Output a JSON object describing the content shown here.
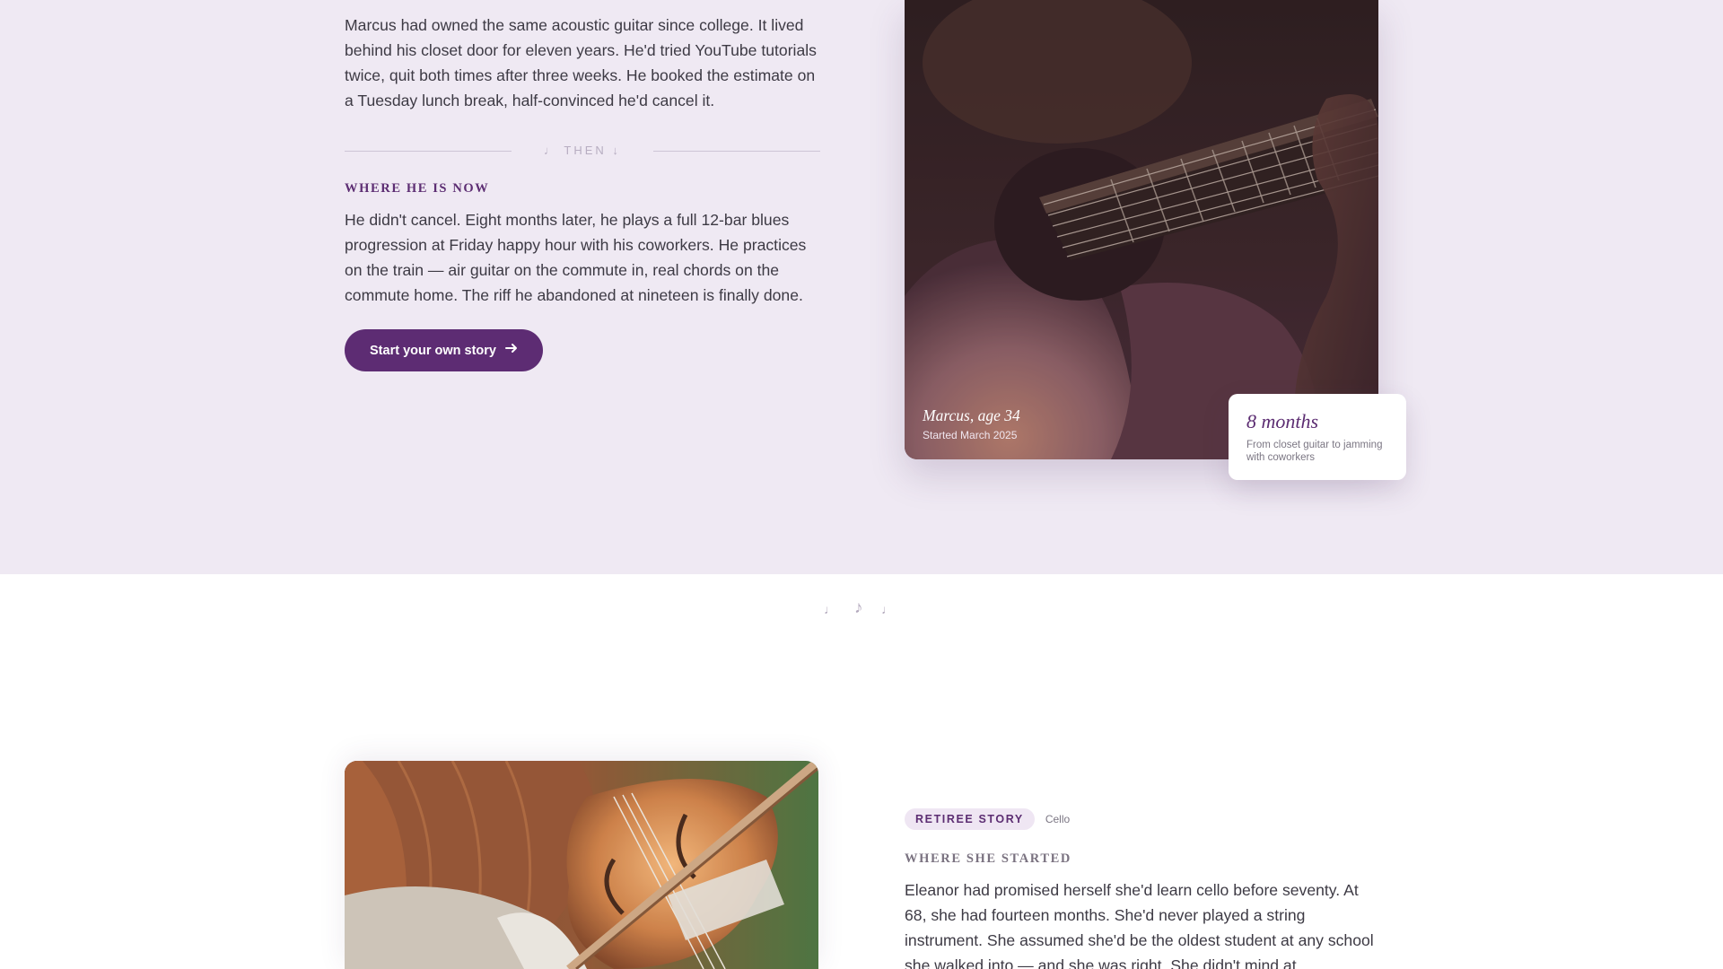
{
  "story_one": {
    "before_text": "Marcus had owned the same acoustic guitar since college. It lived behind his closet door for eleven years. He'd tried YouTube tutorials twice, quit both times after three weeks. He booked the estimate on a Tuesday lunch break, half-convinced he'd cancel it.",
    "divider_label": "♩ THEN ↓",
    "now_heading": "WHERE HE IS NOW",
    "now_text": "He didn't cancel. Eight months later, he plays a full 12-bar blues progression at Friday happy hour with his coworkers. He practices on the train — air guitar on the commute in, real chords on the commute home. The riff he abandoned at nineteen is finally done.",
    "cta_label": "Start your own story",
    "cta_icon": "arrow-right-icon",
    "photo_name": "Marcus, age 34",
    "photo_since": "Started March 2025",
    "stat_big": "8 months",
    "stat_small": "From closet guitar to jamming with coworkers"
  },
  "separator": {
    "notes": [
      "♩",
      "♪",
      "♩"
    ]
  },
  "story_two": {
    "tag": "RETIREE STORY",
    "instrument": "Cello",
    "started_heading": "WHERE SHE STARTED",
    "started_text": "Eleanor had promised herself she'd learn cello before seventy. At 68, she had fourteen months. She'd never played a string instrument. She assumed she'd be the oldest student at any school she walked into — and she was right. She didn't mind at"
  },
  "colors": {
    "accent": "#5d2c73",
    "section_bg": "#efe9f3",
    "text": "#3d3a44"
  }
}
